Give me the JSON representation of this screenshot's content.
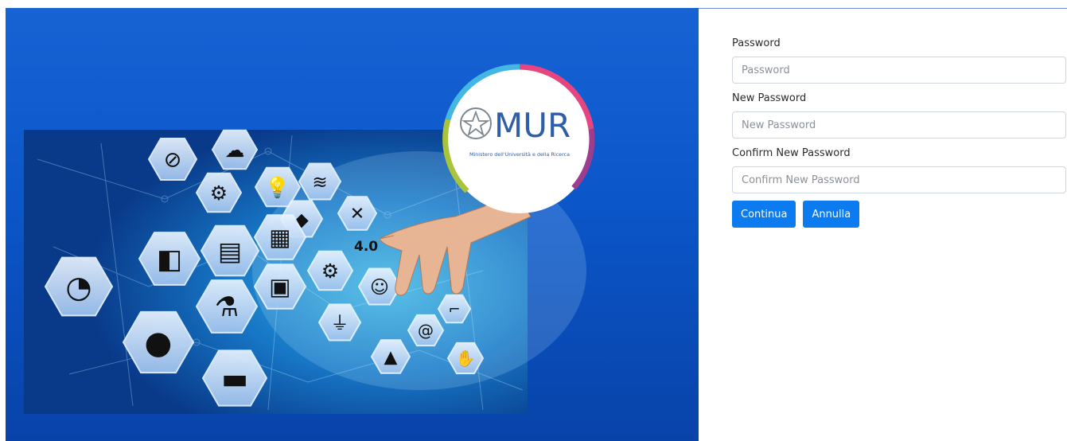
{
  "brand": {
    "name": "MUR",
    "subtitle": "Ministero dell'Università e della Ricerca"
  },
  "hero": {
    "badge_text": "4.0"
  },
  "form": {
    "password_label": "Password",
    "password_placeholder": "Password",
    "new_password_label": "New Password",
    "new_password_placeholder": "New Password",
    "confirm_label": "Confirm New Password",
    "confirm_placeholder": "Confirm New Password",
    "continue_label": "Continua",
    "cancel_label": "Annulla"
  },
  "colors": {
    "hero_blue": "#0b56c9",
    "button_blue": "#0d7bf0",
    "logo_blue": "#2e5fa8"
  },
  "icons": [
    "no-connection-icon",
    "cloud-icon",
    "gears-icon",
    "lightbulb-icon",
    "wifi-icon",
    "robot-icon",
    "tools-icon",
    "pie-chart-icon",
    "world-map-icon",
    "stats-icon",
    "barcode-icon",
    "chip-icon",
    "gear-wrench-icon",
    "worker-icon",
    "flask-icon",
    "plug-icon",
    "head-gears-icon",
    "truck-icon",
    "rocket-icon",
    "at-sign-icon",
    "robot-arm-icon",
    "handshake-icon"
  ]
}
